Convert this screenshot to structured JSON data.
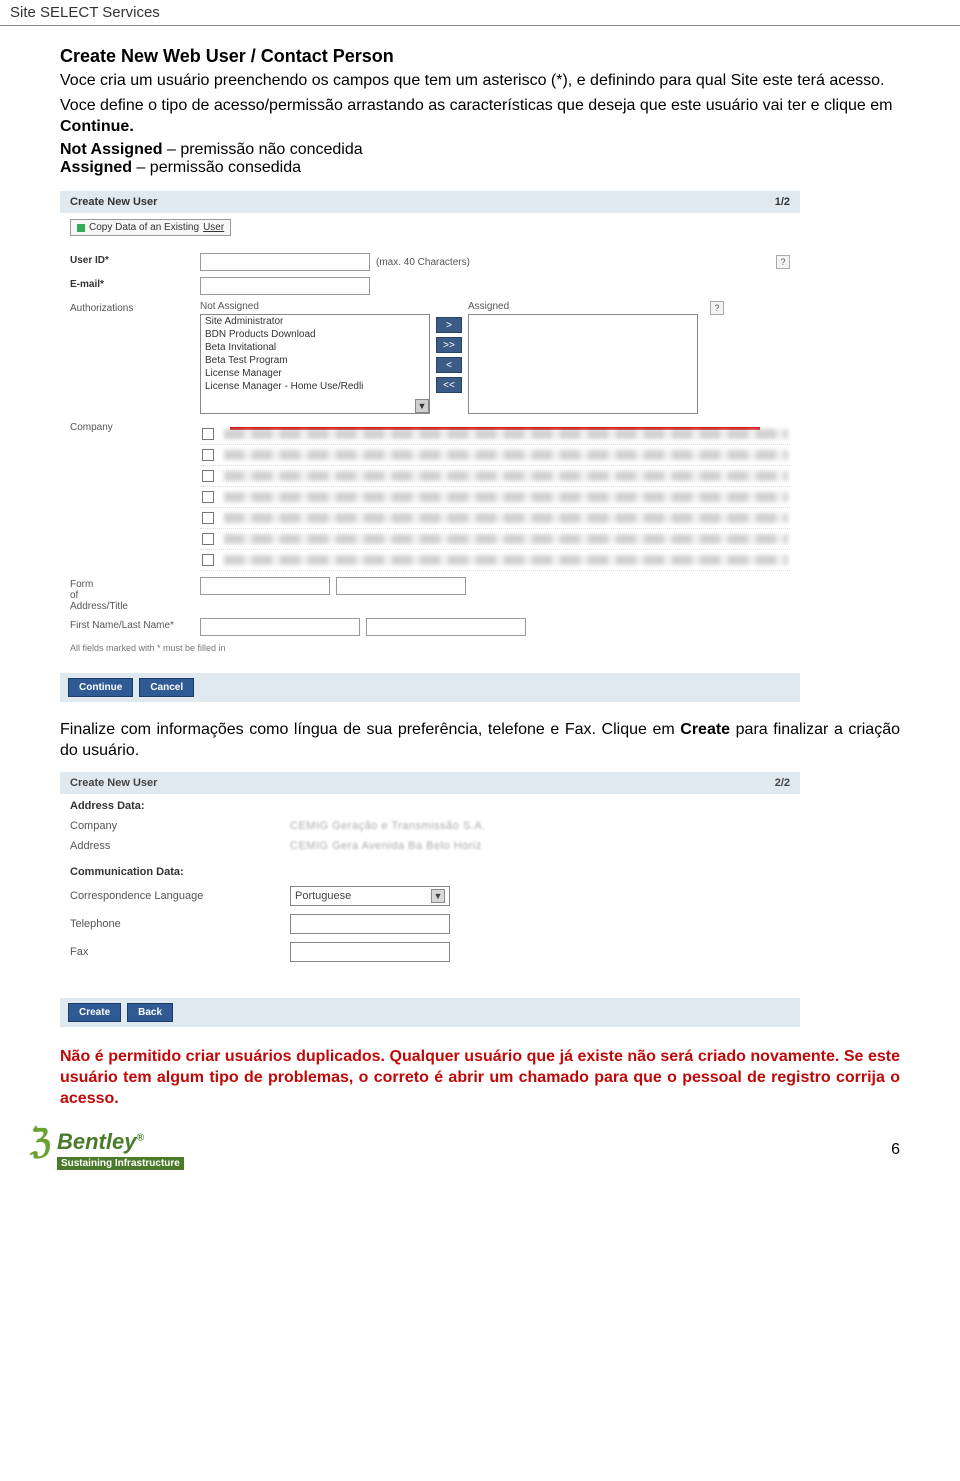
{
  "doc_header": "Site SELECT Services",
  "heading": "Create New Web User / Contact Person",
  "intro_1": "Voce cria um usuário preenchendo os campos que tem um asterisco (*), e definindo para qual Site este terá acesso.",
  "intro_2a": "Voce define o tipo de acesso/permissão arrastando as características que deseja que este usuário vai ter e clique em ",
  "intro_2b": "Continue.",
  "def_na_b": "Not Assigned",
  "def_na_t": " – premissão não concedida",
  "def_a_b": "Assigned",
  "def_a_t": " – permissão consedida",
  "s1": {
    "panel_title": "Create New User",
    "step": "1/2",
    "copy_btn": "Copy Data of an Existing ",
    "copy_btn_underlined": "User",
    "labels": {
      "user_id": "User ID*",
      "email": "E-mail*",
      "auth": "Authorizations",
      "company": "Company",
      "form": "Form\nof\nAddress/Title",
      "name": "First Name/Last Name*"
    },
    "user_hint": "(max. 40 Characters)",
    "notassigned_head": "Not Assigned",
    "assigned_head": "Assigned",
    "opts": [
      "Site Administrator",
      "BDN Products Download",
      "Beta Invitational",
      "Beta Test Program",
      "License Manager",
      "License Manager - Home Use/Redli"
    ],
    "move": {
      "r": ">",
      "rr": ">>",
      "l": "<",
      "ll": "<<"
    },
    "mustfill": "All fields marked with * must be filled in",
    "continue": "Continue",
    "cancel": "Cancel"
  },
  "mid_a": "Finalize com informações como língua de sua preferência, telefone e Fax. Clique em ",
  "mid_b": "Create",
  "mid_c": " para finalizar a criação do usuário.",
  "s2": {
    "panel_title": "Create New User",
    "step": "2/2",
    "addr_h": "Address Data:",
    "company_l": "Company",
    "company_v": "CEMIG Geração e Transmissão S.A.",
    "address_l": "Address",
    "address_v": "CEMIG Gera   Avenida Ba   Belo Horiz",
    "comm_h": "Communication Data:",
    "lang_l": "Correspondence Language",
    "lang_v": "Portuguese",
    "tel_l": "Telephone",
    "fax_l": "Fax",
    "create": "Create",
    "back": "Back"
  },
  "warn": "Não é permitido criar usuários duplicados. Qualquer usuário que já existe não será criado novamente. Se este usuário tem algum tipo de problemas, o correto é abrir um chamado para que o pessoal de registro corrija o acesso.",
  "footer": {
    "brand": "Bentley",
    "sub": "Sustaining Infrastructure",
    "page": "6"
  }
}
